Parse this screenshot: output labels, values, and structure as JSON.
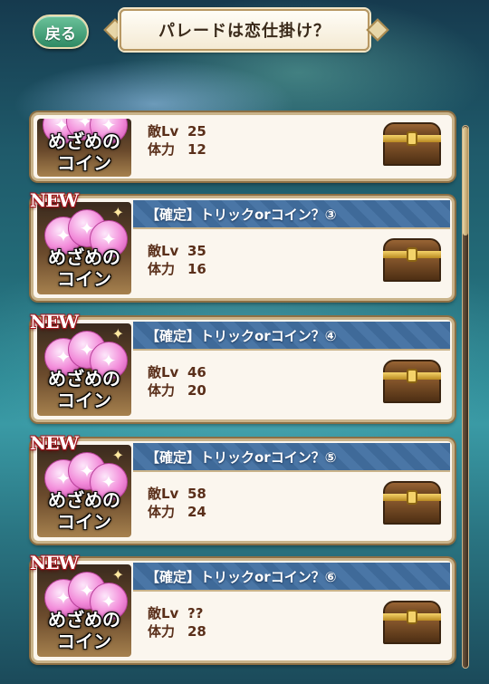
{
  "header": {
    "back_label": "戻る",
    "title": "パレードは恋仕掛け？"
  },
  "thumb_label_line1": "めざめの",
  "thumb_label_line2": "コイン",
  "new_label": "NEW",
  "stat_labels": {
    "level": "敵Lv",
    "hp": "体力"
  },
  "quests": [
    {
      "title": "",
      "level": "25",
      "hp": "12",
      "is_new": false
    },
    {
      "title": "【確定】トリックorコイン？③",
      "level": "35",
      "hp": "16",
      "is_new": true
    },
    {
      "title": "【確定】トリックorコイン？④",
      "level": "46",
      "hp": "20",
      "is_new": true
    },
    {
      "title": "【確定】トリックorコイン？⑤",
      "level": "58",
      "hp": "24",
      "is_new": true
    },
    {
      "title": "【確定】トリックorコイン？⑥",
      "level": "??",
      "hp": "28",
      "is_new": true
    }
  ],
  "icons": {
    "reward": "treasure-chest-icon",
    "coin": "pink-coin-icon"
  },
  "colors": {
    "title_bar": "#4a76a6",
    "stat_text": "#5a2f1a",
    "back_button": "#2f8a64"
  }
}
